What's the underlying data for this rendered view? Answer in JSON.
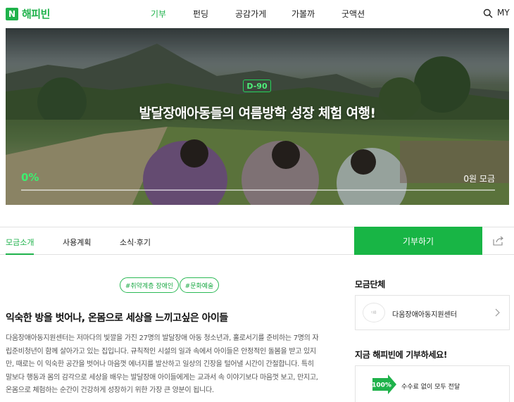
{
  "header": {
    "logo_badge": "N",
    "logo_text": "해피빈",
    "nav": [
      "기부",
      "펀딩",
      "공감가게",
      "가볼까",
      "굿액션"
    ],
    "my_label": "MY",
    "accent_color": "#1fb24b"
  },
  "hero": {
    "dday": "D-90",
    "title": "발달장애아동들의 여름방학 성장 체험 여행!",
    "percent_text": "0%",
    "raised_text": "0원 모금",
    "progress": 0
  },
  "tabs": {
    "items": [
      "모금소개",
      "사용계획",
      "소식·후기"
    ],
    "donate_button": "기부하기",
    "share_icon": "share-icon"
  },
  "content": {
    "tags": [
      "#취약계층 장애인",
      "#문화예술"
    ],
    "title": "익숙한 방을 벗어나, 온몸으로 세상을 느끼고싶은 아이들",
    "body_lines": [
      "다움장애아동지원센터는 저마다의 빛깔을 가진 27명의 발달장애 아동 청소년과, 홀로서기를 준비하는 7명의 자",
      "립준비청년이 함께 살아가고 있는 집입니다. 규칙적인 시설의 일과 속에서 아이들은 안정적인 돌봄을 받고 있지",
      "만, 때로는 이 익숙한 공간을 벗어나 마음껏 에너지를 발산하고 일상의 긴장을 털어낼 시간이 간절합니다. 특히",
      "말보다 행동과 몸의 감각으로 세상을 배우는 발달장애 아이들에게는 교과서 속 이야기보다 마음껏 보고, 만지고,",
      "온몸으로 체험하는 순간이 건강하게 성장하기 위한 가장 큰 양분이 됩니다."
    ]
  },
  "sidebar": {
    "org_section_title": "모금단체",
    "org_logo_text": "다움",
    "org_name": "다움장애아동지원센터",
    "cta_title": "지금 해피빈에 기부하세요!",
    "fee_badge": "100%",
    "fee_text": "수수료 없이 모두 전달"
  }
}
